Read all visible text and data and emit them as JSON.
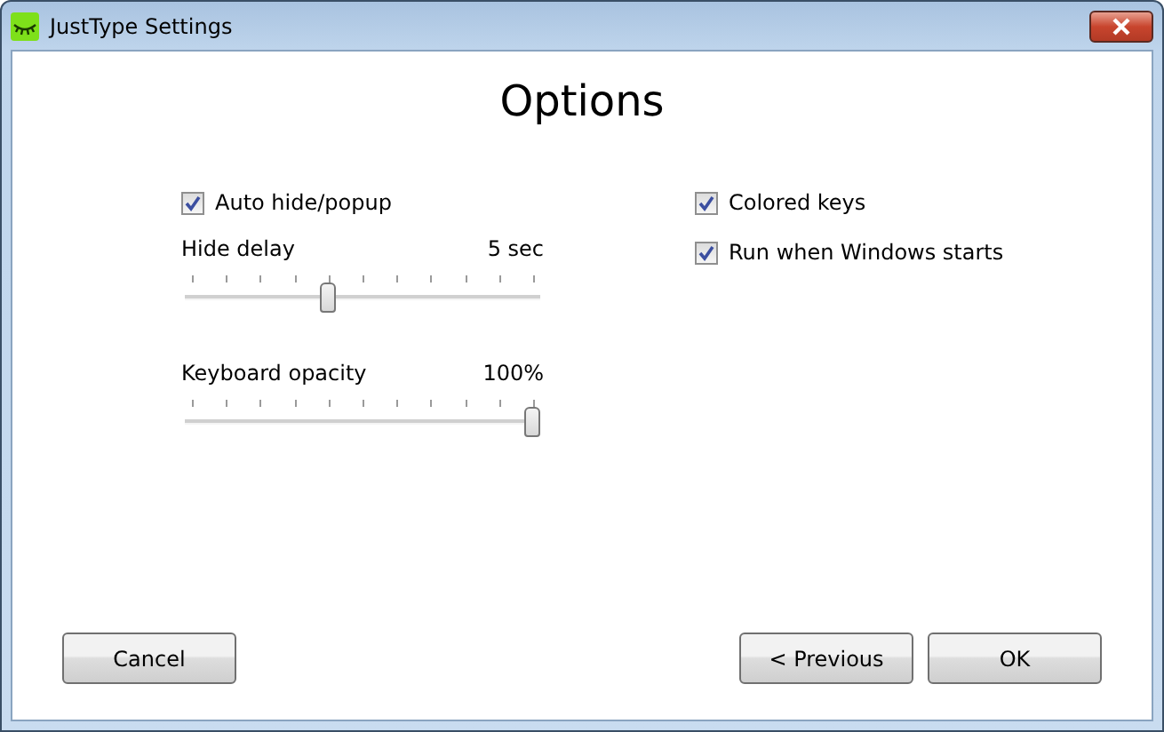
{
  "window": {
    "title": "JustType Settings"
  },
  "heading": "Options",
  "left_options": [
    {
      "kind": "checkbox",
      "label": "Auto hide/popup",
      "checked": true
    },
    {
      "kind": "slider",
      "label": "Hide delay",
      "reading": "5 sec",
      "level": 0.4
    },
    {
      "kind": "slider",
      "label": "Keyboard opacity",
      "reading": "100%",
      "level": 1
    }
  ],
  "right_options": [
    {
      "kind": "checkbox",
      "label": "Colored keys",
      "checked": true
    },
    {
      "kind": "checkbox",
      "label": "Run when Windows starts",
      "checked": true
    }
  ],
  "buttons_left": [
    "Cancel"
  ],
  "buttons_right": [
    "< Previous",
    "OK"
  ]
}
